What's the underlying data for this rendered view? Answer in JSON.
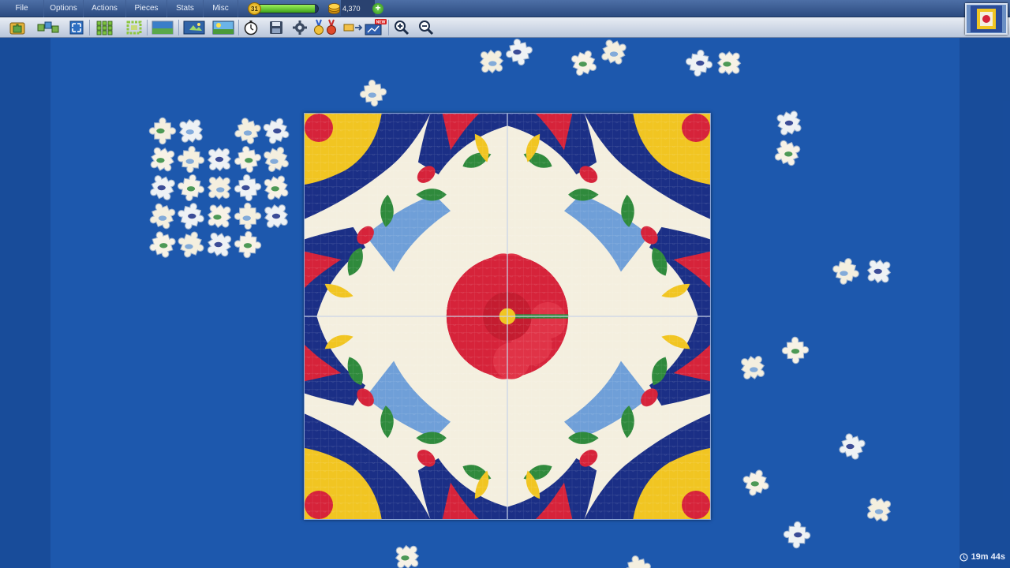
{
  "menu": {
    "items": [
      "File",
      "Options",
      "Actions",
      "Pieces",
      "Stats",
      "Misc"
    ]
  },
  "status": {
    "level": "31",
    "xp_progress": 0.95,
    "coins": "4,370",
    "plus_label": "+"
  },
  "toolbar": {
    "tools": [
      "puzzle-box-icon",
      "scatter-pieces-icon",
      "fullscreen-icon",
      "pieces-grid-icon",
      "edge-pieces-icon",
      "background-icon",
      "ghost-image-icon",
      "preview-image-icon",
      "stopwatch-icon",
      "save-icon",
      "settings-gear-icon",
      "medals-icon",
      "trays-icon",
      "new-feature-icon",
      "zoom-in-icon",
      "zoom-out-icon"
    ],
    "new_badge": "NEW"
  },
  "colors": {
    "background": "#1d58ad",
    "tile_navy": "#1b2f86",
    "tile_yellow": "#f1c522",
    "tile_red": "#d6233a",
    "tile_green": "#2f8a3c",
    "tile_cream": "#f4efdf",
    "tile_lightblue": "#6f9fd8"
  },
  "timer": {
    "value": "19m 44s"
  }
}
